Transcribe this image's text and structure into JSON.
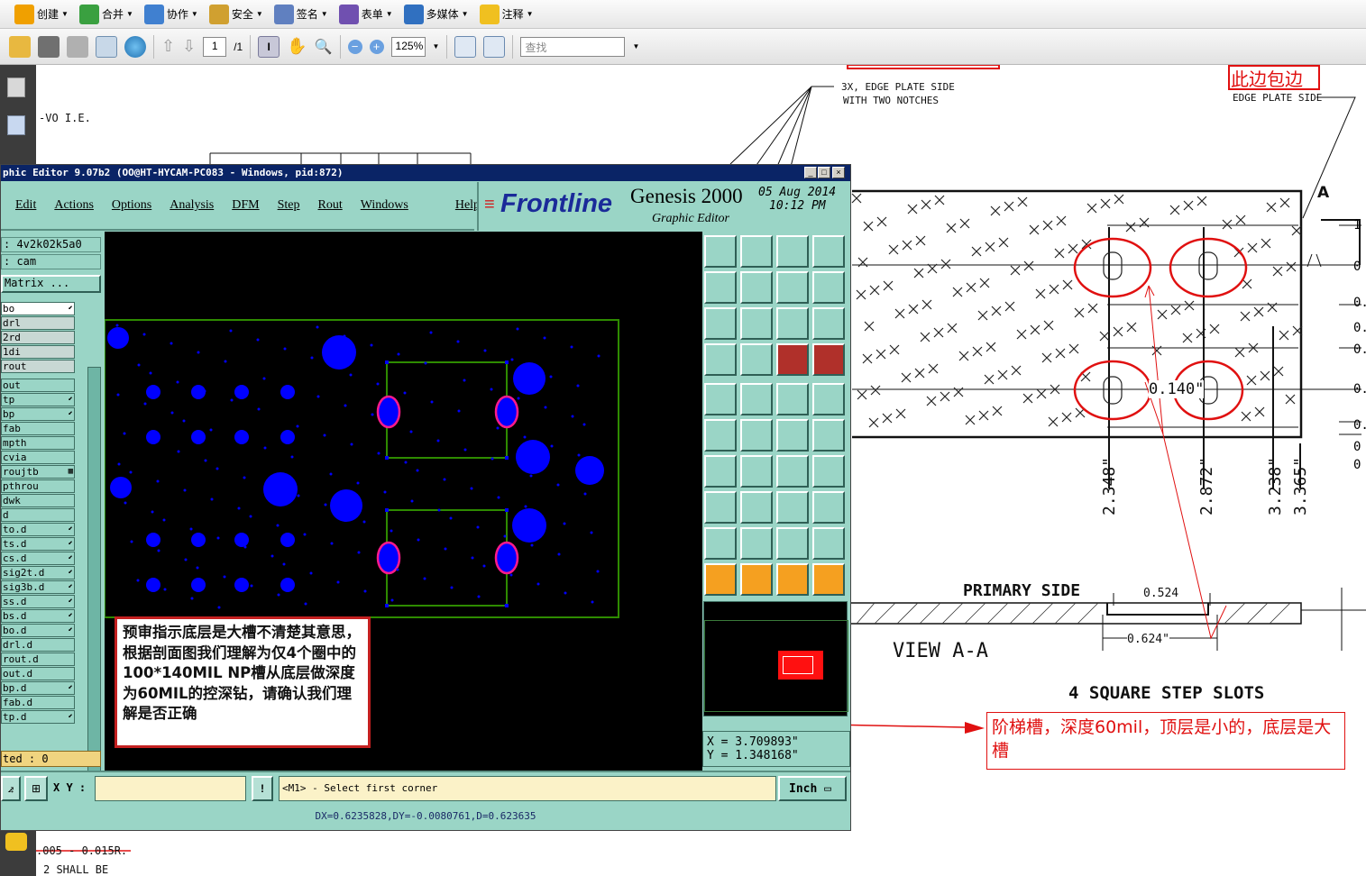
{
  "pdf": {
    "toolbar1": [
      {
        "label": "创建",
        "icon": "create-icon",
        "color": "#f0a000"
      },
      {
        "label": "合并",
        "icon": "combine-icon",
        "color": "#3aa040"
      },
      {
        "label": "协作",
        "icon": "collaborate-icon",
        "color": "#4080d0"
      },
      {
        "label": "安全",
        "icon": "lock-icon",
        "color": "#d0a030"
      },
      {
        "label": "签名",
        "icon": "pen-icon",
        "color": "#6080c0"
      },
      {
        "label": "表单",
        "icon": "form-icon",
        "color": "#7050b0"
      },
      {
        "label": "多媒体",
        "icon": "multimedia-icon",
        "color": "#3070c0"
      },
      {
        "label": "注释",
        "icon": "comment-icon",
        "color": "#f0c020"
      }
    ],
    "page_current": "1",
    "page_total": "/1",
    "zoom": "125%",
    "search_placeholder": "查找"
  },
  "drawing": {
    "vo_text": "-VO I.E.",
    "notch_note_1": "3X, EDGE PLATE SIDE",
    "notch_note_2": "WITH TWO NOTCHES",
    "edge_cn": "此边包边",
    "edge_en": "EDGE PLATE SIDE",
    "section_mark": "A",
    "dims": [
      "2.348\"",
      "2.872\"",
      "3.238\"",
      "3.365\""
    ],
    "slot_width": "0.140\"",
    "primary_side": "PRIMARY SIDE",
    "dim_0524": "0.524",
    "dim_0624": "0.624\"",
    "view": "VIEW A-A",
    "slots_title": "4 SQUARE STEP SLOTS",
    "bottom_1": ".005 - 0.015R.",
    "bottom_2": "2 SHALL BE",
    "right_edge_marks": [
      "1",
      "0",
      "0.",
      "0.",
      "0.",
      "0.",
      "0.",
      "0",
      "0"
    ]
  },
  "genesis": {
    "title": "phic Editor 9.07b2 (OO@HT-HYCAM-PC083 - Windows, pid:872)",
    "menu": [
      "Edit",
      "Actions",
      "Options",
      "Analysis",
      "DFM",
      "Step",
      "Rout",
      "Windows",
      "Help"
    ],
    "brand": "Frontline",
    "product": "Genesis 2000",
    "subtitle": "Graphic Editor",
    "date": "05 Aug 2014",
    "time": "10:12 PM",
    "job": ": 4v2k02k5a0",
    "step": ": cam",
    "matrix_btn": "Matrix ...",
    "layers": [
      {
        "name": "bo",
        "mk": "⬋",
        "sel": true
      },
      {
        "name": "drl",
        "mk": "",
        "grey": true
      },
      {
        "name": "2rd",
        "mk": "",
        "grey": true
      },
      {
        "name": "1di",
        "mk": "",
        "grey": true
      },
      {
        "name": "rout",
        "mk": "",
        "grey": true
      },
      {
        "name": "out",
        "mk": ""
      },
      {
        "name": "tp",
        "mk": "⬋"
      },
      {
        "name": "bp",
        "mk": "⬋"
      },
      {
        "name": "fab",
        "mk": ""
      },
      {
        "name": "mpth",
        "mk": ""
      },
      {
        "name": "cvia",
        "mk": ""
      },
      {
        "name": "roujtb",
        "mk": "▦"
      },
      {
        "name": "pthrou",
        "mk": ""
      },
      {
        "name": "dwk",
        "mk": ""
      },
      {
        "name": "d",
        "mk": ""
      },
      {
        "name": "to.d",
        "mk": "⬋"
      },
      {
        "name": "ts.d",
        "mk": "⬋"
      },
      {
        "name": "cs.d",
        "mk": "⬋"
      },
      {
        "name": "sig2t.d",
        "mk": "⬋"
      },
      {
        "name": "sig3b.d",
        "mk": "⬋"
      },
      {
        "name": "ss.d",
        "mk": "⬋"
      },
      {
        "name": "bs.d",
        "mk": "⬋"
      },
      {
        "name": "bo.d",
        "mk": "⬋"
      },
      {
        "name": "drl.d",
        "mk": ""
      },
      {
        "name": "rout.d",
        "mk": ""
      },
      {
        "name": "out.d",
        "mk": ""
      },
      {
        "name": "bp.d",
        "mk": "⬋"
      },
      {
        "name": "fab.d",
        "mk": ""
      },
      {
        "name": "tp.d",
        "mk": "⬋"
      }
    ],
    "selected_count": "ted : 0",
    "coord_x": "X = 3.709893\"",
    "coord_y": "Y = 1.348168\"",
    "xy_label": "X Y :",
    "prompt": "<M1> - Select first corner",
    "units": "Inch",
    "dx": "DX=0.6235828,DY=-0.0080761,D=0.623635"
  },
  "annotations": {
    "left": "预审指示底层是大槽不清楚其意思，根据剖面图我们理解为仅4个圈中的100*140MIL NP槽从底层做深度为60MIL的控深钻，请确认我们理解是否正确",
    "right": "阶梯槽，深度60mil，顶层是小的，底层是大槽"
  },
  "colors": {
    "pad": "#0000ff",
    "slot_outline": "#ff1a8c",
    "board_outline": "#2e8b00",
    "annot_red": "#e01010"
  }
}
